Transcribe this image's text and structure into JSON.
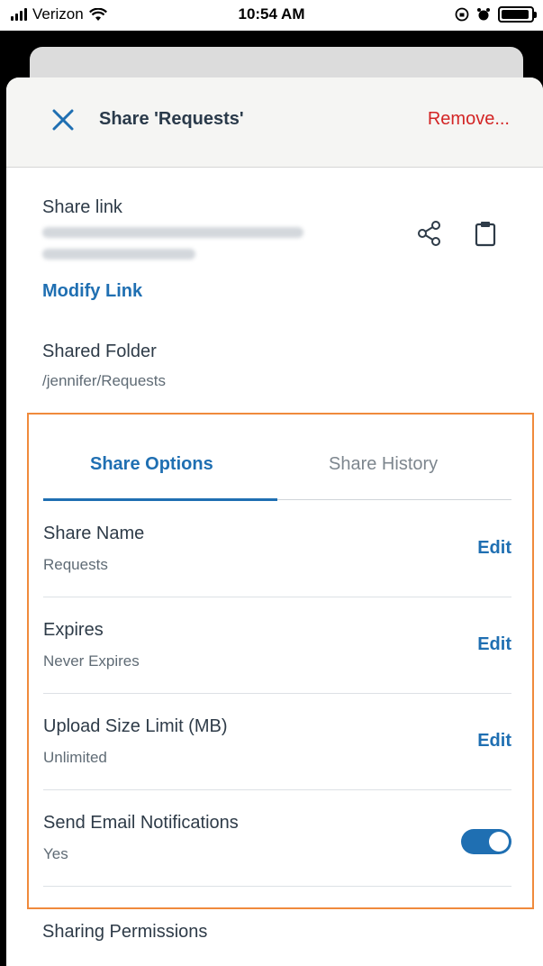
{
  "status_bar": {
    "carrier": "Verizon",
    "time": "10:54 AM",
    "battery_level": 0.95
  },
  "header": {
    "title": "Share 'Requests'",
    "remove_label": "Remove..."
  },
  "share_link": {
    "label": "Share link",
    "modify_label": "Modify Link"
  },
  "shared_folder": {
    "label": "Shared Folder",
    "path": "/jennifer/Requests"
  },
  "tabs": {
    "active": "Share Options",
    "inactive": "Share History"
  },
  "options": {
    "share_name": {
      "title": "Share Name",
      "value": "Requests",
      "action": "Edit"
    },
    "expires": {
      "title": "Expires",
      "value": "Never Expires",
      "action": "Edit"
    },
    "upload_limit": {
      "title": "Upload Size Limit (MB)",
      "value": "Unlimited",
      "action": "Edit"
    },
    "email_notifications": {
      "title": "Send Email Notifications",
      "value": "Yes",
      "enabled": true
    }
  },
  "sharing_permissions": {
    "label": "Sharing Permissions"
  },
  "colors": {
    "accent": "#1f6fb2",
    "danger": "#d32525",
    "highlight": "#f08a3c"
  }
}
